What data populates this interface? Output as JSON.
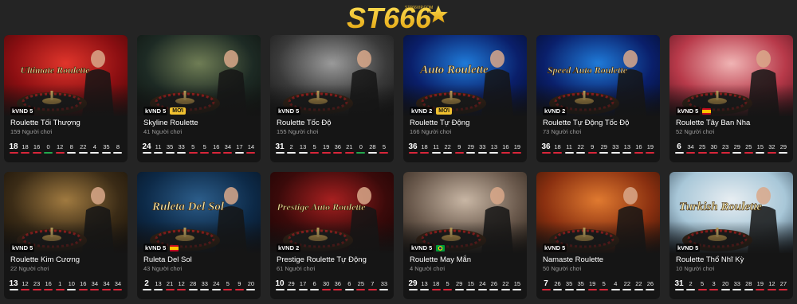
{
  "header": {
    "logo_text": "ST666",
    "logo_subtext": "ST666VIP.COM"
  },
  "colors": {
    "background": "#242424",
    "card": "#151515",
    "red_result": "#d9263a",
    "black_result": "#f0f0f0",
    "green_result": "#23a84d",
    "new_badge": "#f2c230"
  },
  "tables": [
    {
      "name": "Roulette Tối Thượng",
      "players": "159 Người chơi",
      "bet": "kVND 5",
      "new": "",
      "flag": "",
      "overlay": "Ultimate Roulette",
      "theme": "red",
      "results": [
        {
          "v": "18",
          "c": "red"
        },
        {
          "v": "18",
          "c": "red"
        },
        {
          "v": "16",
          "c": "red"
        },
        {
          "v": "0",
          "c": "green"
        },
        {
          "v": "12",
          "c": "red"
        },
        {
          "v": "8",
          "c": "black"
        },
        {
          "v": "22",
          "c": "black"
        },
        {
          "v": "4",
          "c": "black"
        },
        {
          "v": "35",
          "c": "black"
        },
        {
          "v": "8",
          "c": "black"
        }
      ]
    },
    {
      "name": "Skyline Roulette",
      "players": "41 Người chơi",
      "bet": "kVND 5",
      "new": "MỚI",
      "flag": "",
      "overlay": "",
      "theme": "city",
      "results": [
        {
          "v": "24",
          "c": "black"
        },
        {
          "v": "11",
          "c": "black"
        },
        {
          "v": "35",
          "c": "black"
        },
        {
          "v": "33",
          "c": "black"
        },
        {
          "v": "5",
          "c": "red"
        },
        {
          "v": "5",
          "c": "red"
        },
        {
          "v": "16",
          "c": "red"
        },
        {
          "v": "34",
          "c": "red"
        },
        {
          "v": "17",
          "c": "black"
        },
        {
          "v": "14",
          "c": "red"
        }
      ]
    },
    {
      "name": "Roulette Tốc Độ",
      "players": "155 Người chơi",
      "bet": "kVND 5",
      "new": "",
      "flag": "",
      "overlay": "",
      "theme": "studio",
      "results": [
        {
          "v": "31",
          "c": "black"
        },
        {
          "v": "2",
          "c": "black"
        },
        {
          "v": "13",
          "c": "black"
        },
        {
          "v": "5",
          "c": "red"
        },
        {
          "v": "19",
          "c": "red"
        },
        {
          "v": "36",
          "c": "red"
        },
        {
          "v": "21",
          "c": "red"
        },
        {
          "v": "0",
          "c": "green"
        },
        {
          "v": "28",
          "c": "black"
        },
        {
          "v": "5",
          "c": "red"
        }
      ]
    },
    {
      "name": "Roulette Tự Động",
      "players": "166 Người chơi",
      "bet": "kVND 2",
      "new": "MỚI",
      "flag": "",
      "overlay": "Auto Roulette",
      "theme": "blue",
      "results": [
        {
          "v": "36",
          "c": "red"
        },
        {
          "v": "18",
          "c": "red"
        },
        {
          "v": "11",
          "c": "black"
        },
        {
          "v": "22",
          "c": "black"
        },
        {
          "v": "9",
          "c": "red"
        },
        {
          "v": "29",
          "c": "black"
        },
        {
          "v": "33",
          "c": "black"
        },
        {
          "v": "13",
          "c": "black"
        },
        {
          "v": "16",
          "c": "red"
        },
        {
          "v": "19",
          "c": "red"
        }
      ]
    },
    {
      "name": "Roulette Tự Động Tốc Độ",
      "players": "73 Người chơi",
      "bet": "kVND 2",
      "new": "",
      "flag": "",
      "overlay": "Speed Auto Roulette",
      "theme": "blue",
      "results": [
        {
          "v": "36",
          "c": "red"
        },
        {
          "v": "18",
          "c": "red"
        },
        {
          "v": "11",
          "c": "black"
        },
        {
          "v": "22",
          "c": "black"
        },
        {
          "v": "9",
          "c": "red"
        },
        {
          "v": "29",
          "c": "black"
        },
        {
          "v": "33",
          "c": "black"
        },
        {
          "v": "13",
          "c": "black"
        },
        {
          "v": "16",
          "c": "red"
        },
        {
          "v": "19",
          "c": "red"
        }
      ]
    },
    {
      "name": "Roulette Tây Ban Nha",
      "players": "52 Người chơi",
      "bet": "kVND 5",
      "new": "",
      "flag": "es",
      "overlay": "",
      "theme": "pink",
      "results": [
        {
          "v": "6",
          "c": "black"
        },
        {
          "v": "34",
          "c": "red"
        },
        {
          "v": "25",
          "c": "red"
        },
        {
          "v": "30",
          "c": "red"
        },
        {
          "v": "23",
          "c": "red"
        },
        {
          "v": "29",
          "c": "black"
        },
        {
          "v": "25",
          "c": "red"
        },
        {
          "v": "15",
          "c": "black"
        },
        {
          "v": "32",
          "c": "red"
        },
        {
          "v": "29",
          "c": "black"
        }
      ]
    },
    {
      "name": "Roulette Kim Cương",
      "players": "22 Người chơi",
      "bet": "kVND 5",
      "new": "",
      "flag": "",
      "overlay": "",
      "theme": "casino",
      "results": [
        {
          "v": "13",
          "c": "black"
        },
        {
          "v": "12",
          "c": "red"
        },
        {
          "v": "23",
          "c": "red"
        },
        {
          "v": "16",
          "c": "red"
        },
        {
          "v": "1",
          "c": "red"
        },
        {
          "v": "10",
          "c": "black"
        },
        {
          "v": "16",
          "c": "red"
        },
        {
          "v": "34",
          "c": "red"
        },
        {
          "v": "34",
          "c": "red"
        },
        {
          "v": "34",
          "c": "red"
        }
      ]
    },
    {
      "name": "Ruleta Del Sol",
      "players": "43 Người chơi",
      "bet": "kVND 5",
      "new": "",
      "flag": "es",
      "overlay": "Ruleta Del Sol",
      "theme": "navy",
      "results": [
        {
          "v": "2",
          "c": "black"
        },
        {
          "v": "13",
          "c": "black"
        },
        {
          "v": "21",
          "c": "red"
        },
        {
          "v": "12",
          "c": "red"
        },
        {
          "v": "28",
          "c": "black"
        },
        {
          "v": "33",
          "c": "black"
        },
        {
          "v": "24",
          "c": "black"
        },
        {
          "v": "5",
          "c": "red"
        },
        {
          "v": "9",
          "c": "red"
        },
        {
          "v": "20",
          "c": "black"
        }
      ]
    },
    {
      "name": "Prestige Roulette Tự Động",
      "players": "61 Người chơi",
      "bet": "kVND 2",
      "new": "",
      "flag": "",
      "overlay": "Prestige Auto Roulette",
      "theme": "maroon",
      "results": [
        {
          "v": "10",
          "c": "black"
        },
        {
          "v": "29",
          "c": "black"
        },
        {
          "v": "17",
          "c": "black"
        },
        {
          "v": "6",
          "c": "black"
        },
        {
          "v": "30",
          "c": "red"
        },
        {
          "v": "36",
          "c": "red"
        },
        {
          "v": "6",
          "c": "black"
        },
        {
          "v": "25",
          "c": "red"
        },
        {
          "v": "7",
          "c": "red"
        },
        {
          "v": "33",
          "c": "black"
        }
      ]
    },
    {
      "name": "Roulette May Mắn",
      "players": "4 Người chơi",
      "bet": "kVND 5",
      "new": "",
      "flag": "br",
      "overlay": "",
      "theme": "studio2",
      "results": [
        {
          "v": "29",
          "c": "black"
        },
        {
          "v": "13",
          "c": "black"
        },
        {
          "v": "18",
          "c": "red"
        },
        {
          "v": "5",
          "c": "red"
        },
        {
          "v": "29",
          "c": "black"
        },
        {
          "v": "15",
          "c": "black"
        },
        {
          "v": "24",
          "c": "black"
        },
        {
          "v": "26",
          "c": "black"
        },
        {
          "v": "22",
          "c": "black"
        },
        {
          "v": "15",
          "c": "black"
        }
      ]
    },
    {
      "name": "Namaste Roulette",
      "players": "50 Người chơi",
      "bet": "kVND 5",
      "new": "",
      "flag": "",
      "overlay": "",
      "theme": "orange",
      "results": [
        {
          "v": "7",
          "c": "red"
        },
        {
          "v": "26",
          "c": "black"
        },
        {
          "v": "35",
          "c": "black"
        },
        {
          "v": "35",
          "c": "black"
        },
        {
          "v": "19",
          "c": "red"
        },
        {
          "v": "5",
          "c": "red"
        },
        {
          "v": "4",
          "c": "black"
        },
        {
          "v": "22",
          "c": "black"
        },
        {
          "v": "22",
          "c": "black"
        },
        {
          "v": "26",
          "c": "black"
        }
      ]
    },
    {
      "name": "Roulette Thổ Nhĩ Kỳ",
      "players": "10 Người chơi",
      "bet": "kVND 5",
      "new": "",
      "flag": "",
      "overlay": "Turkish Roulette",
      "theme": "light",
      "results": [
        {
          "v": "31",
          "c": "black"
        },
        {
          "v": "2",
          "c": "black"
        },
        {
          "v": "5",
          "c": "red"
        },
        {
          "v": "3",
          "c": "red"
        },
        {
          "v": "20",
          "c": "black"
        },
        {
          "v": "33",
          "c": "black"
        },
        {
          "v": "28",
          "c": "black"
        },
        {
          "v": "19",
          "c": "red"
        },
        {
          "v": "12",
          "c": "red"
        },
        {
          "v": "27",
          "c": "red"
        }
      ]
    }
  ]
}
